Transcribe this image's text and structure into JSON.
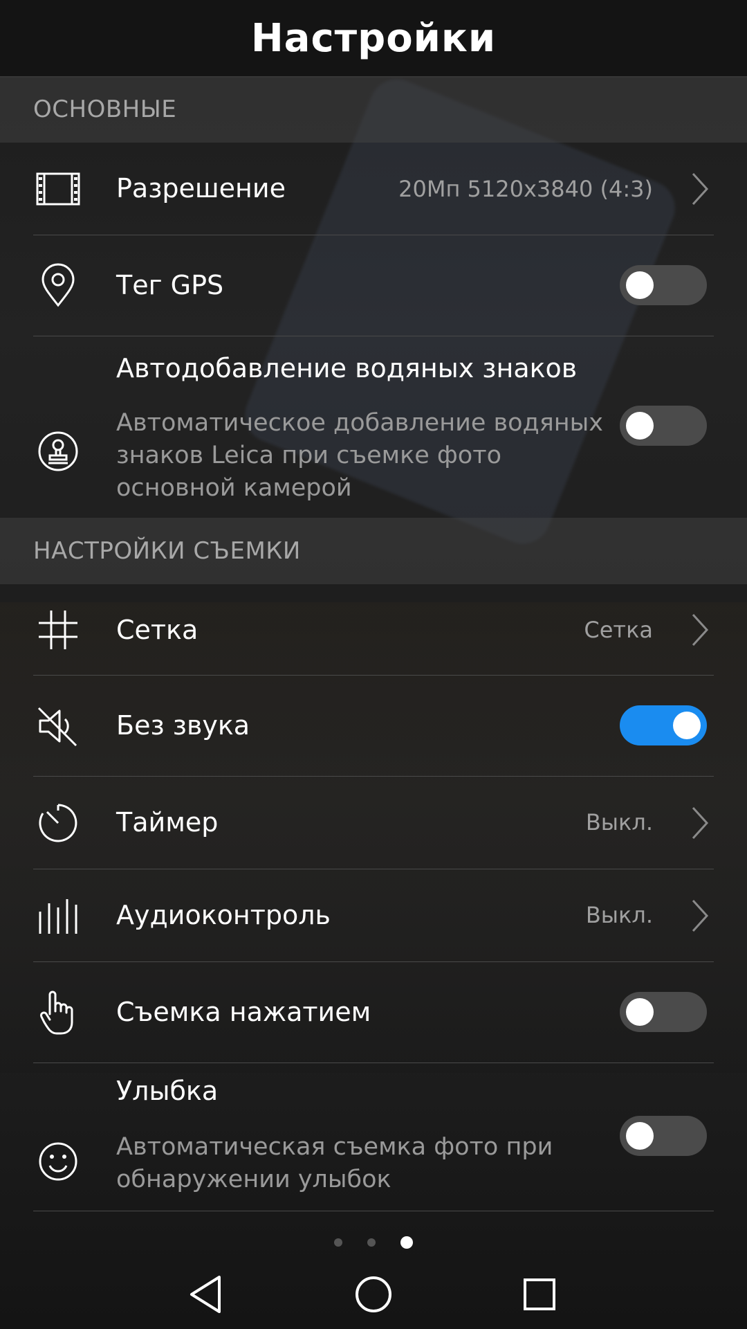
{
  "header": {
    "title": "Настройки"
  },
  "sections": {
    "main": {
      "label": "ОСНОВНЫЕ"
    },
    "capture": {
      "label": "НАСТРОЙКИ СЪЕМКИ"
    }
  },
  "rows": {
    "resolution": {
      "label": "Разрешение",
      "value": "20Мп 5120x3840 (4:3)",
      "icon": "film-frame-icon"
    },
    "gps": {
      "label": "Тег GPS",
      "toggle": false,
      "icon": "location-pin-icon"
    },
    "watermark": {
      "label": "Автодобавление водяных знаков",
      "description": "Автоматическое добавление водяных знаков Leica при съемке фото основной камерой",
      "toggle": false,
      "icon": "stamp-icon"
    },
    "grid": {
      "label": "Сетка",
      "value": "Сетка",
      "icon": "grid-hash-icon"
    },
    "mute": {
      "label": "Без звука",
      "toggle": true,
      "icon": "speaker-muted-icon"
    },
    "timer": {
      "label": "Таймер",
      "value": "Выкл.",
      "icon": "timer-icon"
    },
    "audio_control": {
      "label": "Аудиоконтроль",
      "value": "Выкл.",
      "icon": "audio-bars-icon"
    },
    "touch_capture": {
      "label": "Съемка нажатием",
      "toggle": false,
      "icon": "hand-pointer-icon"
    },
    "smile": {
      "label": "Улыбка",
      "description": "Автоматическая съемка фото при обнаружении улыбок",
      "toggle": false,
      "icon": "smile-face-icon"
    }
  },
  "pager": {
    "pages": 3,
    "active_index": 2
  },
  "colors": {
    "toggle_on": "#1a8cf0",
    "toggle_off": "#4b4b4b",
    "section_text": "#a8a8a8",
    "value_text": "#a0a0a0"
  },
  "navbar": {
    "icons": [
      "back-triangle-icon",
      "home-circle-icon",
      "recents-square-icon"
    ]
  }
}
